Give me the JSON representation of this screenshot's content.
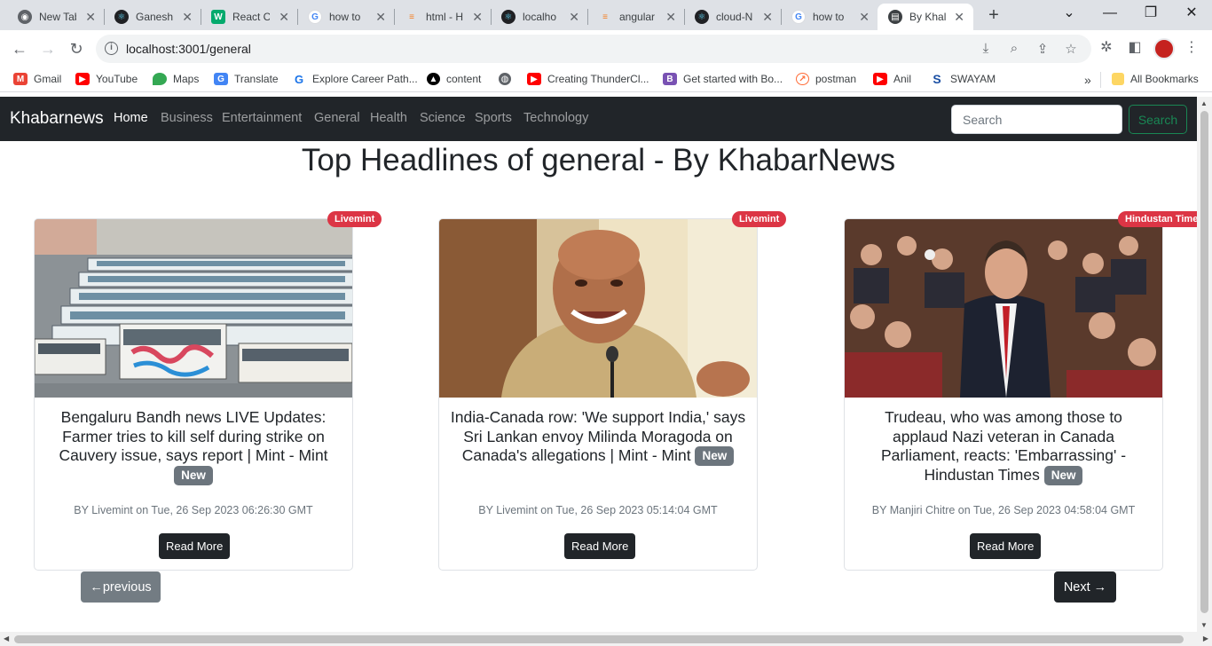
{
  "browser": {
    "tabs": [
      {
        "title": "New Tab",
        "icon": "chrome-icon",
        "color": "#5f6368"
      },
      {
        "title": "Ganesh",
        "icon": "react-icon",
        "color": "#202124"
      },
      {
        "title": "React C",
        "icon": "w3schools-icon",
        "color": "#04aa6d"
      },
      {
        "title": "how to",
        "icon": "google-icon",
        "color": "#4285f4"
      },
      {
        "title": "html - H",
        "icon": "stackoverflow-icon",
        "color": "#f48024"
      },
      {
        "title": "localho",
        "icon": "react-icon",
        "color": "#202124"
      },
      {
        "title": "angular",
        "icon": "stackoverflow-icon",
        "color": "#f48024"
      },
      {
        "title": "cloud-N",
        "icon": "react-icon",
        "color": "#202124"
      },
      {
        "title": "how to",
        "icon": "google-icon",
        "color": "#4285f4"
      },
      {
        "title": "By Khal",
        "icon": "news-icon",
        "color": "#3c4043"
      }
    ],
    "url": "localhost:3001/general",
    "bookmarks": [
      {
        "label": "Gmail",
        "icon": "gmail-icon",
        "color": "#ea4335"
      },
      {
        "label": "YouTube",
        "icon": "youtube-icon",
        "color": "#ff0000"
      },
      {
        "label": "Maps",
        "icon": "maps-icon",
        "color": "#34a853"
      },
      {
        "label": "Translate",
        "icon": "translate-icon",
        "color": "#4285f4"
      },
      {
        "label": "Explore Career Path...",
        "icon": "career-icon",
        "color": "#1a73e8"
      },
      {
        "label": "content",
        "icon": "content-icon",
        "color": "#000000"
      },
      {
        "label": "",
        "icon": "globe-icon",
        "color": "#5f6368"
      },
      {
        "label": "Creating ThunderCl...",
        "icon": "youtube-icon",
        "color": "#ff0000"
      },
      {
        "label": "Get started with Bo...",
        "icon": "bootstrap-icon",
        "color": "#7952b3"
      },
      {
        "label": "postman",
        "icon": "postman-icon",
        "color": "#ff6c37"
      },
      {
        "label": "Anil",
        "icon": "youtube-icon",
        "color": "#ff0000"
      },
      {
        "label": "SWAYAM",
        "icon": "swayam-icon",
        "color": "#1a4fa3"
      }
    ],
    "all_bookmarks": "All Bookmarks"
  },
  "navbar": {
    "brand": "Khabarnews",
    "links": [
      "Home",
      "Business",
      "Entertainment",
      "General",
      "Health",
      "Science",
      "Sports",
      "Technology"
    ],
    "active": "Home",
    "search_placeholder": "Search",
    "search_button": "Search"
  },
  "heading": "Top Headlines of general - By KhabarNews",
  "cards": [
    {
      "source": "Livemint",
      "title": "Bengaluru Bandh news LIVE Updates: Farmer tries to kill self during strike on Cauvery issue, says report | Mint - Mint",
      "new_label": "New",
      "meta": "BY Livemint on Tue, 26 Sep 2023 06:26:30 GMT",
      "read_more": "Read More",
      "image": "bus-depot-image"
    },
    {
      "source": "Livemint",
      "title": "India-Canada row: 'We support India,' says Sri Lankan envoy Milinda Moragoda on Canada's allegations | Mint - Mint",
      "new_label": "New",
      "meta": "BY Livemint on Tue, 26 Sep 2023 05:14:04 GMT",
      "read_more": "Read More",
      "image": "envoy-portrait-image"
    },
    {
      "source": "Hindustan Times",
      "title": "Trudeau, who was among those to applaud Nazi veteran in Canada Parliament, reacts: 'Embarrassing' - Hindustan Times",
      "new_label": "New",
      "meta": "BY Manjiri Chitre on Tue, 26 Sep 2023 04:58:04 GMT",
      "read_more": "Read More",
      "image": "parliament-image"
    }
  ],
  "pagination": {
    "previous": "←previous",
    "next": "Next →"
  }
}
